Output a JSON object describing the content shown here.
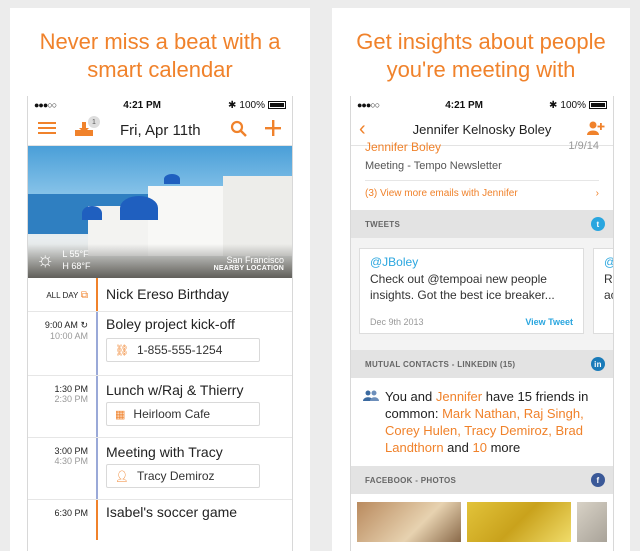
{
  "left_panel": {
    "headline_line1": "Never miss a beat with a",
    "headline_line2": "smart calendar",
    "status": {
      "signal": "●●●○○",
      "wifi": "wifi-icon",
      "time": "4:21 PM",
      "bt": "bluetooth-icon",
      "battery": "100%"
    },
    "appbar": {
      "date": "Fri, Apr 11th",
      "badge": "1"
    },
    "hero": {
      "low": "L 55°F",
      "high": "H 68°F",
      "city": "San Francisco",
      "nearby": "NEARBY LOCATION"
    },
    "events": [
      {
        "time": "ALL DAY",
        "sub": "",
        "name": "Nick Ereso Birthday",
        "detail": "",
        "bar": "#f0822b",
        "icon": "gift-icon"
      },
      {
        "time": "9:00 AM",
        "sub": "10:00 AM",
        "name": "Boley project kick-off",
        "detail": "1-855-555-1254",
        "bar": "#9aa9d8",
        "icon": "link-icon"
      },
      {
        "time": "1:30 PM",
        "sub": "2:30 PM",
        "name": "Lunch w/Raj & Thierry",
        "detail": "Heirloom Cafe",
        "bar": "#9aa9d8",
        "icon": "map-icon"
      },
      {
        "time": "3:00 PM",
        "sub": "4:30 PM",
        "name": "Meeting with Tracy",
        "detail": "Tracy Demiroz",
        "bar": "#9aa9d8",
        "icon": "person-icon"
      },
      {
        "time": "6:30 PM",
        "sub": "",
        "name": "Isabel's soccer game",
        "detail": "",
        "bar": "#f0822b",
        "icon": ""
      }
    ]
  },
  "right_panel": {
    "headline_line1": "Get insights about people",
    "headline_line2": "you're meeting with",
    "status": {
      "signal": "●●●○○",
      "time": "4:21 PM",
      "battery": "100%"
    },
    "contact_name": "Jennifer Kelnosky Boley",
    "email": {
      "who": "Jennifer Boley",
      "date": "1/9/14",
      "subject": "Meeting - Tempo Newsletter",
      "more": "(3) View more emails with Jennifer"
    },
    "tweets_header": "TWEETS",
    "tweet": {
      "handle": "@JBoley",
      "text": "Check out @tempoai new people insights. Got the best ice breaker...",
      "date": "Dec 9th 2013",
      "view": "View Tweet"
    },
    "tweet2": {
      "handle": "@J",
      "line1": "Re",
      "line2": "ac"
    },
    "mutual_header": "MUTUAL CONTACTS - LINKEDIN (15)",
    "mutual": {
      "p1": "You and ",
      "jennifer": "Jennifer",
      "p2": " have 15 friends in common: ",
      "names": "Mark Nathan, Raj Singh, Corey Hulen, Tracy Demiroz, Brad Landthorn",
      "p3": " and ",
      "ten": "10",
      "p4": " more"
    },
    "facebook_header": "FACEBOOK - PHOTOS"
  }
}
